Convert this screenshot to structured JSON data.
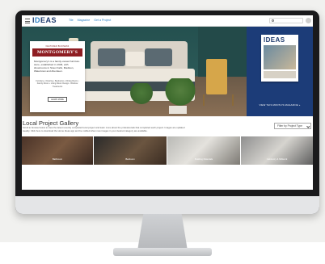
{
  "nav": {
    "logo_prefix": "I",
    "logo_highlight": "D",
    "logo_suffix": "EAS",
    "links": [
      "Tile",
      "Magazine",
      "Get a Project"
    ]
  },
  "promo": {
    "eyebrow": "FEATURED BUSINESS",
    "brand": "MONTGOMERY'S",
    "description": "Montgomery's is a family-owned furniture store, established in 1946, with showrooms in Sioux Falls, Madison, Watertown and Aberdeen.",
    "tags": "Furniture • Flooring • Bedrooms • Dining Room • Family Room • Living Room Design • Window Treatments",
    "button_label": "LEARN MORE"
  },
  "magazine": {
    "logo": "IDEAS",
    "link_label": "VIEW THIS MONTH'S MAGAZINE »"
  },
  "gallery": {
    "title": "Local Project Gallery",
    "description": "Scroll to browse below to view the latest recently completed local project and learn more about the professionals that completed each project. Images are updated weekly. Click here to download the Home Ideas app and be notified when new images in your desired category are available.",
    "filter_label": "Filter by Project Type",
    "tiles": [
      {
        "label": "Bathroom"
      },
      {
        "label": "Bedroom"
      },
      {
        "label": "Building Materials"
      },
      {
        "label": "Cabinetry & Millwork"
      }
    ]
  },
  "colors": {
    "brand_navy": "#1c3c78",
    "brand_accent": "#2a7fc5",
    "promo_red": "#8e1d22"
  }
}
